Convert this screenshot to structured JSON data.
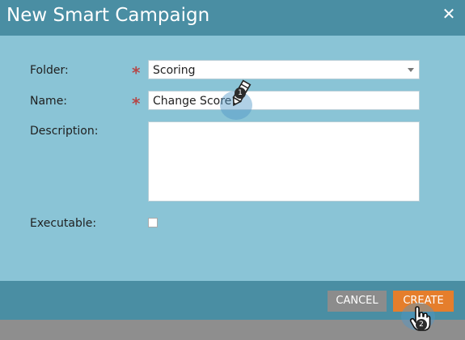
{
  "dialog": {
    "title": "New Smart Campaign",
    "close_icon": "close-icon"
  },
  "form": {
    "folder": {
      "label": "Folder:",
      "value": "Scoring",
      "required": true
    },
    "name": {
      "label": "Name:",
      "value": "Change Score",
      "required": true
    },
    "description": {
      "label": "Description:",
      "value": ""
    },
    "executable": {
      "label": "Executable:",
      "checked": false
    },
    "required_marker": "*"
  },
  "footer": {
    "cancel_label": "CANCEL",
    "create_label": "CREATE"
  },
  "annotations": {
    "step1": "1",
    "step2": "2"
  },
  "colors": {
    "titlebar": "#4a8ea3",
    "body": "#8ac4d6",
    "create": "#e57e2c",
    "cancel": "#8c8c8c",
    "required": "#b44848"
  }
}
